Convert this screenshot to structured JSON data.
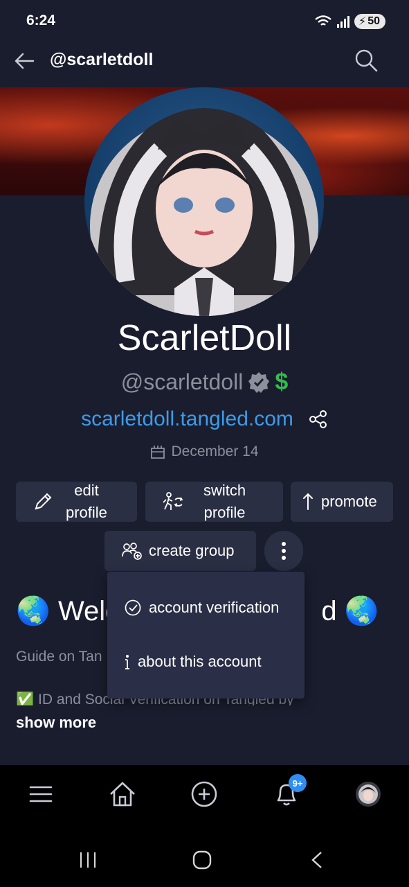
{
  "status_bar": {
    "time": "6:24",
    "battery": "50"
  },
  "header": {
    "title": "@scarletdoll"
  },
  "profile": {
    "display_name": "ScarletDoll",
    "handle": "@scarletdoll",
    "dollar_badge": "$",
    "site_link": "scarletdoll.tangled.com",
    "joined_date": "December 14"
  },
  "actions": {
    "edit_line1": "edit",
    "edit_line2": "profile",
    "switch_line1": "switch",
    "switch_line2": "profile",
    "promote": "promote",
    "create_group": "create group"
  },
  "bio": {
    "welcome_visible": "Welc",
    "welcome_tail": "d",
    "guide_partial": "Guide on Tan",
    "verify_line": "ID and Social Verification on Tangled by",
    "show_more": "show more"
  },
  "menu": {
    "account_verification": "account verification",
    "about_account": "about this account"
  },
  "bottom_nav": {
    "notifications_badge": "9+"
  },
  "icons": [
    "back-arrow-icon",
    "search-icon",
    "verified-icon",
    "share-icon",
    "calendar-icon",
    "pencil-icon",
    "switch-profile-icon",
    "upload-arrow-icon",
    "group-add-icon",
    "more-vertical-icon",
    "check-circle-icon",
    "info-icon",
    "menu-icon",
    "home-icon",
    "add-circle-icon",
    "bell-icon",
    "avatar"
  ],
  "colors": {
    "background": "#1a1d2e",
    "button": "#2b2f44",
    "link": "#3d9be9",
    "dollar": "#2fbf4b",
    "badge": "#2f8ef0"
  }
}
